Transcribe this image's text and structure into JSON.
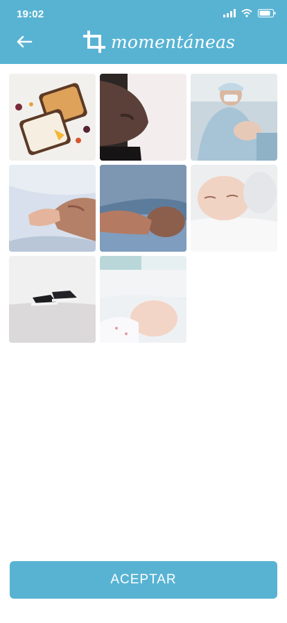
{
  "status_bar": {
    "time": "19:02"
  },
  "header": {
    "app_name": "momentáneas"
  },
  "gallery": {
    "photos": [
      {
        "icon": "food-photo"
      },
      {
        "icon": "pregnancy-photo"
      },
      {
        "icon": "doctor-newborn-photo"
      },
      {
        "icon": "baby-hand-photo"
      },
      {
        "icon": "sleeping-baby-photo"
      },
      {
        "icon": "sleeping-baby-closeup-photo"
      },
      {
        "icon": "baby-shoes-photo"
      },
      {
        "icon": "baby-bed-photo"
      }
    ]
  },
  "footer": {
    "accept_label": "ACEPTAR"
  },
  "colors": {
    "brand": "#58b3d3",
    "background": "#ffffff"
  }
}
